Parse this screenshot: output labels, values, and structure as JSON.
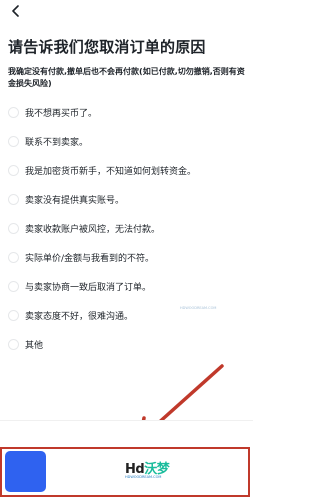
{
  "header": {
    "back_icon": "chevron-left-icon"
  },
  "title": "请告诉我们您取消订单的原因",
  "subtitle": "我确定没有付款,撤单后也不会再付款(如已付款,切勿撤销,否则有资金损失风险)",
  "reasons": [
    {
      "label": "我不想再买币了。"
    },
    {
      "label": "联系不到卖家。"
    },
    {
      "label": "我是加密货币新手，不知道如何划转资金。"
    },
    {
      "label": "卖家没有提供真实账号。"
    },
    {
      "label": "卖家收款账户被风控，无法付款。"
    },
    {
      "label": "实际单价/金额与我看到的不符。"
    },
    {
      "label": "与卖家协商一致后取消了订单。"
    },
    {
      "label": "卖家态度不好，很难沟通。"
    },
    {
      "label": "其他"
    }
  ],
  "watermark": {
    "logo_main": "Hd",
    "logo_cn": "沃梦",
    "url": "HDWOODREAM.COM"
  },
  "colors": {
    "confirm_button": "#2f62f0",
    "annotation_red": "#c0392b"
  }
}
